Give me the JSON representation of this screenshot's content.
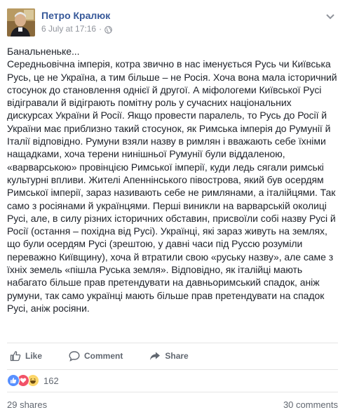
{
  "post": {
    "author": "Петро Кралюк",
    "timestamp": "6 July at 17:16",
    "separator": "·",
    "privacy_icon": "globe-icon",
    "menu_icon": "chevron-down-icon",
    "text": "Банальненьке...\nСередньовічна імперія, котра звично в нас іменується Русь чи Київська Русь, це не Україна, а тим більше – не Росія. Хоча вона мала історичний стосунок до становлення однієї й другої. А міфологеми Київської Русі відігравали й відіграють помітну роль у сучасних національних дискурсах України й Росії. Якщо провести паралель, то Русь до Росії й України має приблизно такий стосунок, як Римська імперія до Румунії й Італії відповідно. Румуни взяли назву в римлян і вважають себе їхніми нащадками, хоча терени нинішньої Румунії були віддаленою, «варварською» провінцією Римської імперії, куди ледь сягали римські культурні впливи. Жителі Апеннінського півострова, який був осердям Римської імперії, зараз називають себе не римлянами, а італійцями. Так само з росіянами й українцями. Перші виникли на варварській околиці Русі, але, в силу різних історичних обставин, присвоїли собі назву Русі й Росії (остання – похідна від Русі). Українці, які зараз живуть на землях, що були осердям Русі (зрештою, у давні часи під Руссю розуміли переважно Київщину), хоча й втратили свою «руську назву», але саме з їхніх земель «пішла Руська земля». Відповідно, як італійці мають набагато більше прав претендувати на давньоримський спадок, аніж румуни, так само українці мають більше прав претендувати на спадок Русі, аніж росіяни."
  },
  "actions": {
    "like_label": "Like",
    "comment_label": "Comment",
    "share_label": "Share"
  },
  "reactions": {
    "icons": [
      "like-icon",
      "love-icon",
      "haha-icon"
    ],
    "count": "162"
  },
  "stats": {
    "shares": "29 shares",
    "comments": "30 comments"
  },
  "colors": {
    "author_link": "#365899",
    "secondary_text": "#90949c",
    "action_text": "#616770",
    "like_blue": "#5890ff",
    "love_red": "#f25268",
    "haha_yellow": "#fcd669"
  }
}
